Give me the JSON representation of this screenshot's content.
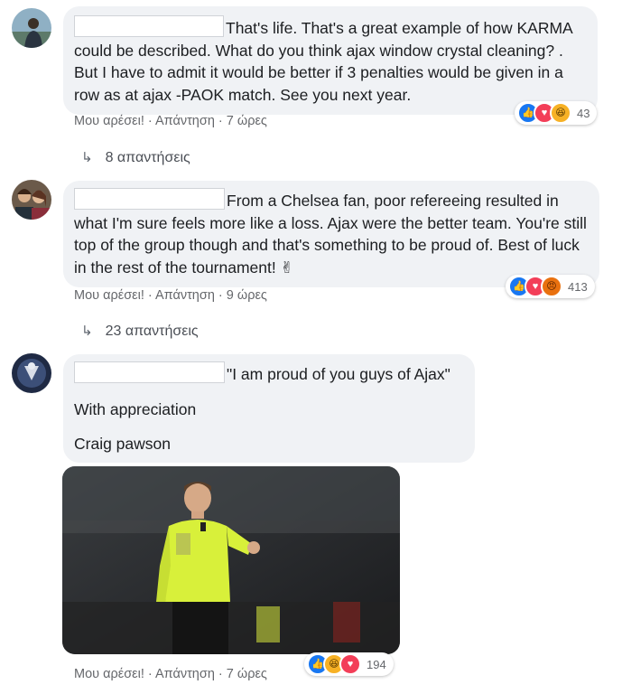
{
  "comments": [
    {
      "text": "That's life. That's a great example of how KARMA could be described. What do you think ajax window crystal cleaning? . But I have to admit it would be better if 3 penalties would be given in a row as at ajax -PAOK match. See you next year.",
      "like_label": "Μου αρέσει!",
      "reply_label": "Απάντηση",
      "time": "7 ώρες",
      "reaction_count": "43",
      "replies": "8 απαντήσεις"
    },
    {
      "text": "From a Chelsea fan, poor refereeing resulted in what I'm sure feels more like a loss. Ajax were the better team. You're still top of the group though and that's something to be proud of. Best of luck in the rest of the tournament! ✌",
      "like_label": "Μου αρέσει!",
      "reply_label": "Απάντηση",
      "time": "9 ώρες",
      "reaction_count": "413",
      "replies": "23 απαντήσεις"
    },
    {
      "line1": "\"I am proud of you guys of Ajax\"",
      "line2": "With appreciation",
      "line3": "Craig pawson",
      "like_label": "Μου αρέσει!",
      "reply_label": "Απάντηση",
      "time": "7 ώρες",
      "reaction_count": "194"
    }
  ],
  "icons": {
    "reply_arrow": "reply-arrow-icon",
    "like": "like-reaction-icon",
    "love": "love-reaction-icon",
    "haha": "haha-reaction-icon",
    "angry": "angry-reaction-icon"
  },
  "colors": {
    "bubble": "#f0f2f5",
    "meta": "#65676b",
    "like": "#1877f2",
    "love": "#f33e58",
    "haha": "#f7b125",
    "referee_shirt": "#d8f03a"
  }
}
